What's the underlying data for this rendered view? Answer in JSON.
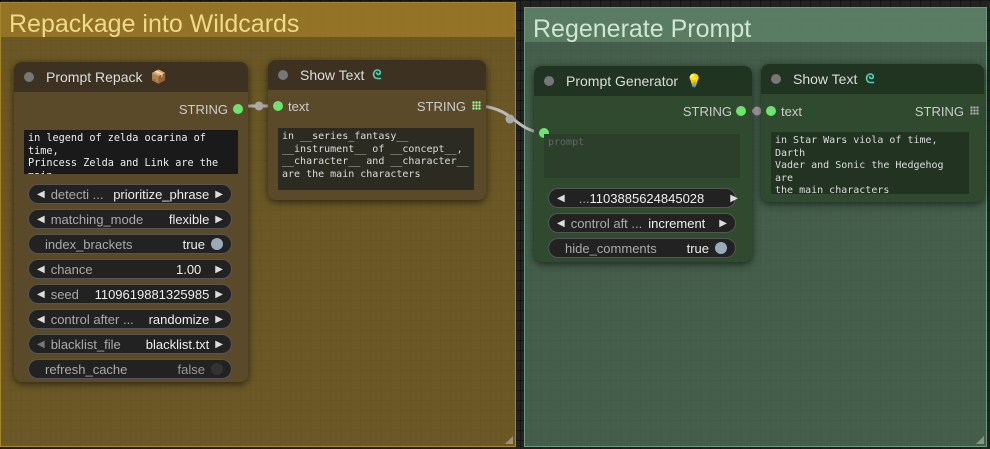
{
  "groups": {
    "repackage": {
      "title": "Repackage into Wildcards"
    },
    "regenerate": {
      "title": "Regenerate Prompt"
    }
  },
  "nodes": {
    "prompt_repack": {
      "title": "Prompt Repack",
      "icon": "package-icon",
      "output_label": "STRING",
      "text": "in legend of zelda ocarina of time,\nPrincess Zelda and Link are the main\ncharacters",
      "widgets": [
        {
          "name": "detecti ...",
          "value": "prioritize_phrase",
          "type": "combo"
        },
        {
          "name": "matching_mode",
          "value": "flexible",
          "type": "combo"
        },
        {
          "name": "index_brackets",
          "value": "true",
          "type": "toggle",
          "on": true
        },
        {
          "name": "chance",
          "value": "1.00",
          "type": "number"
        },
        {
          "name": "seed",
          "value": "1109619881325985",
          "type": "number"
        },
        {
          "name": "control after ...",
          "value": "randomize",
          "type": "combo"
        },
        {
          "name": "blacklist_file",
          "value": "blacklist.txt",
          "type": "combo"
        },
        {
          "name": "refresh_cache",
          "value": "false",
          "type": "toggle",
          "on": false
        }
      ]
    },
    "show_text_1": {
      "title": "Show Text",
      "icon": "link-icon",
      "input_label": "text",
      "output_label": "STRING",
      "text": "in __series_fantasy__\n__instrument__ of __concept__,\n__character__ and __character__\nare the main characters"
    },
    "prompt_generator": {
      "title": "Prompt Generator",
      "icon": "lightbulb-icon",
      "input_label": "prompt",
      "output_label": "STRING",
      "widgets": [
        {
          "name": "...",
          "value": "1103885624845028",
          "type": "number"
        },
        {
          "name": "control aft ...",
          "value": "increment",
          "type": "combo"
        },
        {
          "name": "hide_comments",
          "value": "true",
          "type": "toggle",
          "on": true
        }
      ]
    },
    "show_text_2": {
      "title": "Show Text",
      "icon": "link-icon",
      "input_label": "text",
      "output_label": "STRING",
      "text": "in Star Wars viola of time, Darth\nVader and Sonic the Hedgehog are\nthe main characters"
    }
  },
  "colors": {
    "brown_group": "#886e28",
    "green_group": "#52765c",
    "slot_active": "#6fe36f"
  }
}
